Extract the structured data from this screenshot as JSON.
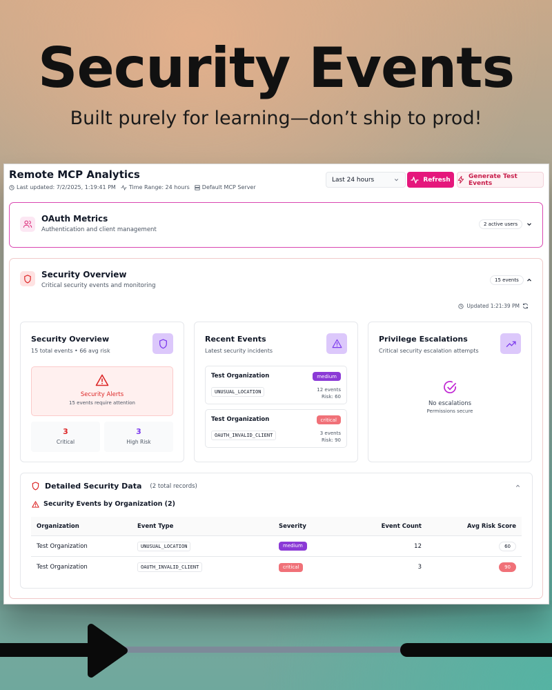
{
  "hero": {
    "title": "Security Events",
    "subtitle": "Built purely for learning—don’t ship to prod!"
  },
  "header": {
    "title": "Remote MCP Analytics",
    "last_updated": "Last updated: 7/2/2025, 1:19:41 PM",
    "time_range": "Time Range: 24 hours",
    "server": "Default MCP Server",
    "range_select": "Last 24 hours",
    "refresh_label": "Refresh",
    "generate_label": "Generate Test Events"
  },
  "oauth": {
    "title": "OAuth Metrics",
    "subtitle": "Authentication and client management",
    "active_users": "2 active users"
  },
  "security": {
    "title": "Security Overview",
    "subtitle": "Critical security events and monitoring",
    "events_pill": "15 events",
    "updated": "Updated 1:21:39 PM",
    "overview_card": {
      "title": "Security Overview",
      "subtitle": "15 total events • 66 avg risk",
      "alert_title": "Security Alerts",
      "alert_sub": "15 events require attention",
      "critical_value": "3",
      "critical_label": "Critical",
      "high_risk_value": "3",
      "high_risk_label": "High Risk"
    },
    "recent_card": {
      "title": "Recent Events",
      "subtitle": "Latest security incidents",
      "events": [
        {
          "org": "Test Organization",
          "severity": "medium",
          "type": "UNUSUAL_LOCATION",
          "count": "12 events",
          "risk": "Risk: 60"
        },
        {
          "org": "Test Organization",
          "severity": "critical",
          "type": "OAUTH_INVALID_CLIENT",
          "count": "3 events",
          "risk": "Risk: 90"
        }
      ]
    },
    "priv_card": {
      "title": "Privilege Escalations",
      "subtitle": "Critical security escalation attempts",
      "empty_title": "No escalations",
      "empty_sub": "Permissions secure"
    }
  },
  "detail": {
    "title": "Detailed Security Data",
    "count": "(2 total records)",
    "section_title": "Security Events by Organization (2)",
    "columns": [
      "Organization",
      "Event Type",
      "Severity",
      "Event Count",
      "Avg Risk Score"
    ],
    "rows": [
      {
        "org": "Test Organization",
        "type": "UNUSUAL_LOCATION",
        "severity": "medium",
        "count": "12",
        "risk": "60"
      },
      {
        "org": "Test Organization",
        "type": "OAUTH_INVALID_CLIENT",
        "severity": "critical",
        "count": "3",
        "risk": "90"
      }
    ]
  },
  "colors": {
    "accent_pink": "#e5177c",
    "critical_red": "#dc2626",
    "high_risk_purple": "#7c3aed",
    "badge_medium": "#8b3ad6",
    "badge_critical": "#f07178"
  }
}
